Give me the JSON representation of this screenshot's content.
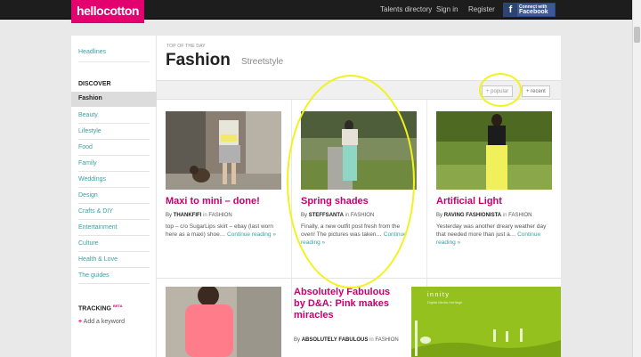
{
  "brand": {
    "logo": "hellocotton",
    "accent": "#e3006f"
  },
  "topnav": {
    "talents": "Talents directory",
    "signin": "Sign in",
    "register": "Register",
    "facebook_line1": "Connect with",
    "facebook_line2": "Facebook",
    "facebook_icon": "f"
  },
  "sidebar": {
    "headlines": "Headlines",
    "discover_heading": "DISCOVER",
    "items": [
      "Fashion",
      "Beauty",
      "Lifestyle",
      "Food",
      "Family",
      "Weddings",
      "Design",
      "Crafts & DIY",
      "Entertainment",
      "Culture",
      "Health & Love",
      "The guides"
    ],
    "active_index": 0,
    "tracking_heading": "TRACKING",
    "tracking_badge": "BETA",
    "add_keyword": "Add a keyword",
    "add_icon": "+"
  },
  "main": {
    "kicker": "TOP OF THE DAY",
    "title": "Fashion",
    "subtitle": "Streetstyle",
    "sort": {
      "popular": "+ popular",
      "recent": "+ recent",
      "active": "popular"
    }
  },
  "cards": [
    {
      "title": "Maxi to mini – done!",
      "by_prefix": "By",
      "author": "THANKFIFI",
      "in_word": "in",
      "category": "FASHION",
      "excerpt": "top – c/o SugarLips skirt – ebay (last worn here as a maxi) shoe…",
      "more": "Continue reading »"
    },
    {
      "title": "Spring shades",
      "by_prefix": "By",
      "author": "STEFFSANTA",
      "in_word": "in",
      "category": "FASHION",
      "excerpt": "Finally, a new outfit post fresh from the oven! The pictures was taken…",
      "more": "Continue reading »"
    },
    {
      "title": "Artificial Light",
      "by_prefix": "By",
      "author": "RAVING FASHIONISTA",
      "in_word": "in",
      "category": "FASHION",
      "excerpt": "Yesterday was another dreary weather day that needed more than just a…",
      "more": "Continue reading »"
    },
    {
      "title": "Absolutely Fabulous by D&A: Pink makes miracles",
      "by_prefix": "By",
      "author": "ABSOLUTELY FABULOUS",
      "in_word": "in",
      "category": "FASHION"
    }
  ],
  "ad": {
    "logo": "innity",
    "tagline": "Digital Media Heritage"
  }
}
